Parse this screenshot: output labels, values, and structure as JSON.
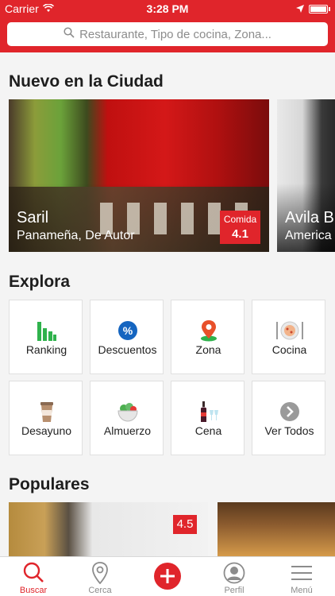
{
  "status_bar": {
    "carrier": "Carrier",
    "time": "3:28 PM"
  },
  "search": {
    "placeholder": "Restaurante, Tipo de cocina, Zona..."
  },
  "new_in_city": {
    "title": "Nuevo en la Ciudad",
    "cards": [
      {
        "name": "Saril",
        "subtitle": "Panameña, De Autor",
        "rating_category": "Comida",
        "rating": "4.1"
      },
      {
        "name": "Avila B",
        "subtitle": "America"
      }
    ]
  },
  "explore": {
    "title": "Explora",
    "tiles": [
      {
        "label": "Ranking",
        "icon": "ranking-bars-icon"
      },
      {
        "label": "Descuentos",
        "icon": "discount-badge-icon"
      },
      {
        "label": "Zona",
        "icon": "map-pin-icon"
      },
      {
        "label": "Cocina",
        "icon": "plate-cutlery-icon"
      },
      {
        "label": "Desayuno",
        "icon": "coffee-cup-icon"
      },
      {
        "label": "Almuerzo",
        "icon": "salad-bowl-icon"
      },
      {
        "label": "Cena",
        "icon": "wine-bottle-icon"
      },
      {
        "label": "Ver Todos",
        "icon": "chevron-right-circle-icon"
      }
    ]
  },
  "popular": {
    "title": "Populares",
    "first_rating": "4.5"
  },
  "tab_bar": {
    "tabs": [
      {
        "label": "Buscar",
        "icon": "search-icon",
        "active": true
      },
      {
        "label": "Cerca",
        "icon": "location-pin-icon"
      },
      {
        "label": "",
        "icon": "add-icon"
      },
      {
        "label": "Perfil",
        "icon": "user-icon"
      },
      {
        "label": "Menú",
        "icon": "hamburger-menu-icon"
      }
    ]
  },
  "colors": {
    "accent": "#e0252b",
    "background": "#f4f4f4"
  }
}
